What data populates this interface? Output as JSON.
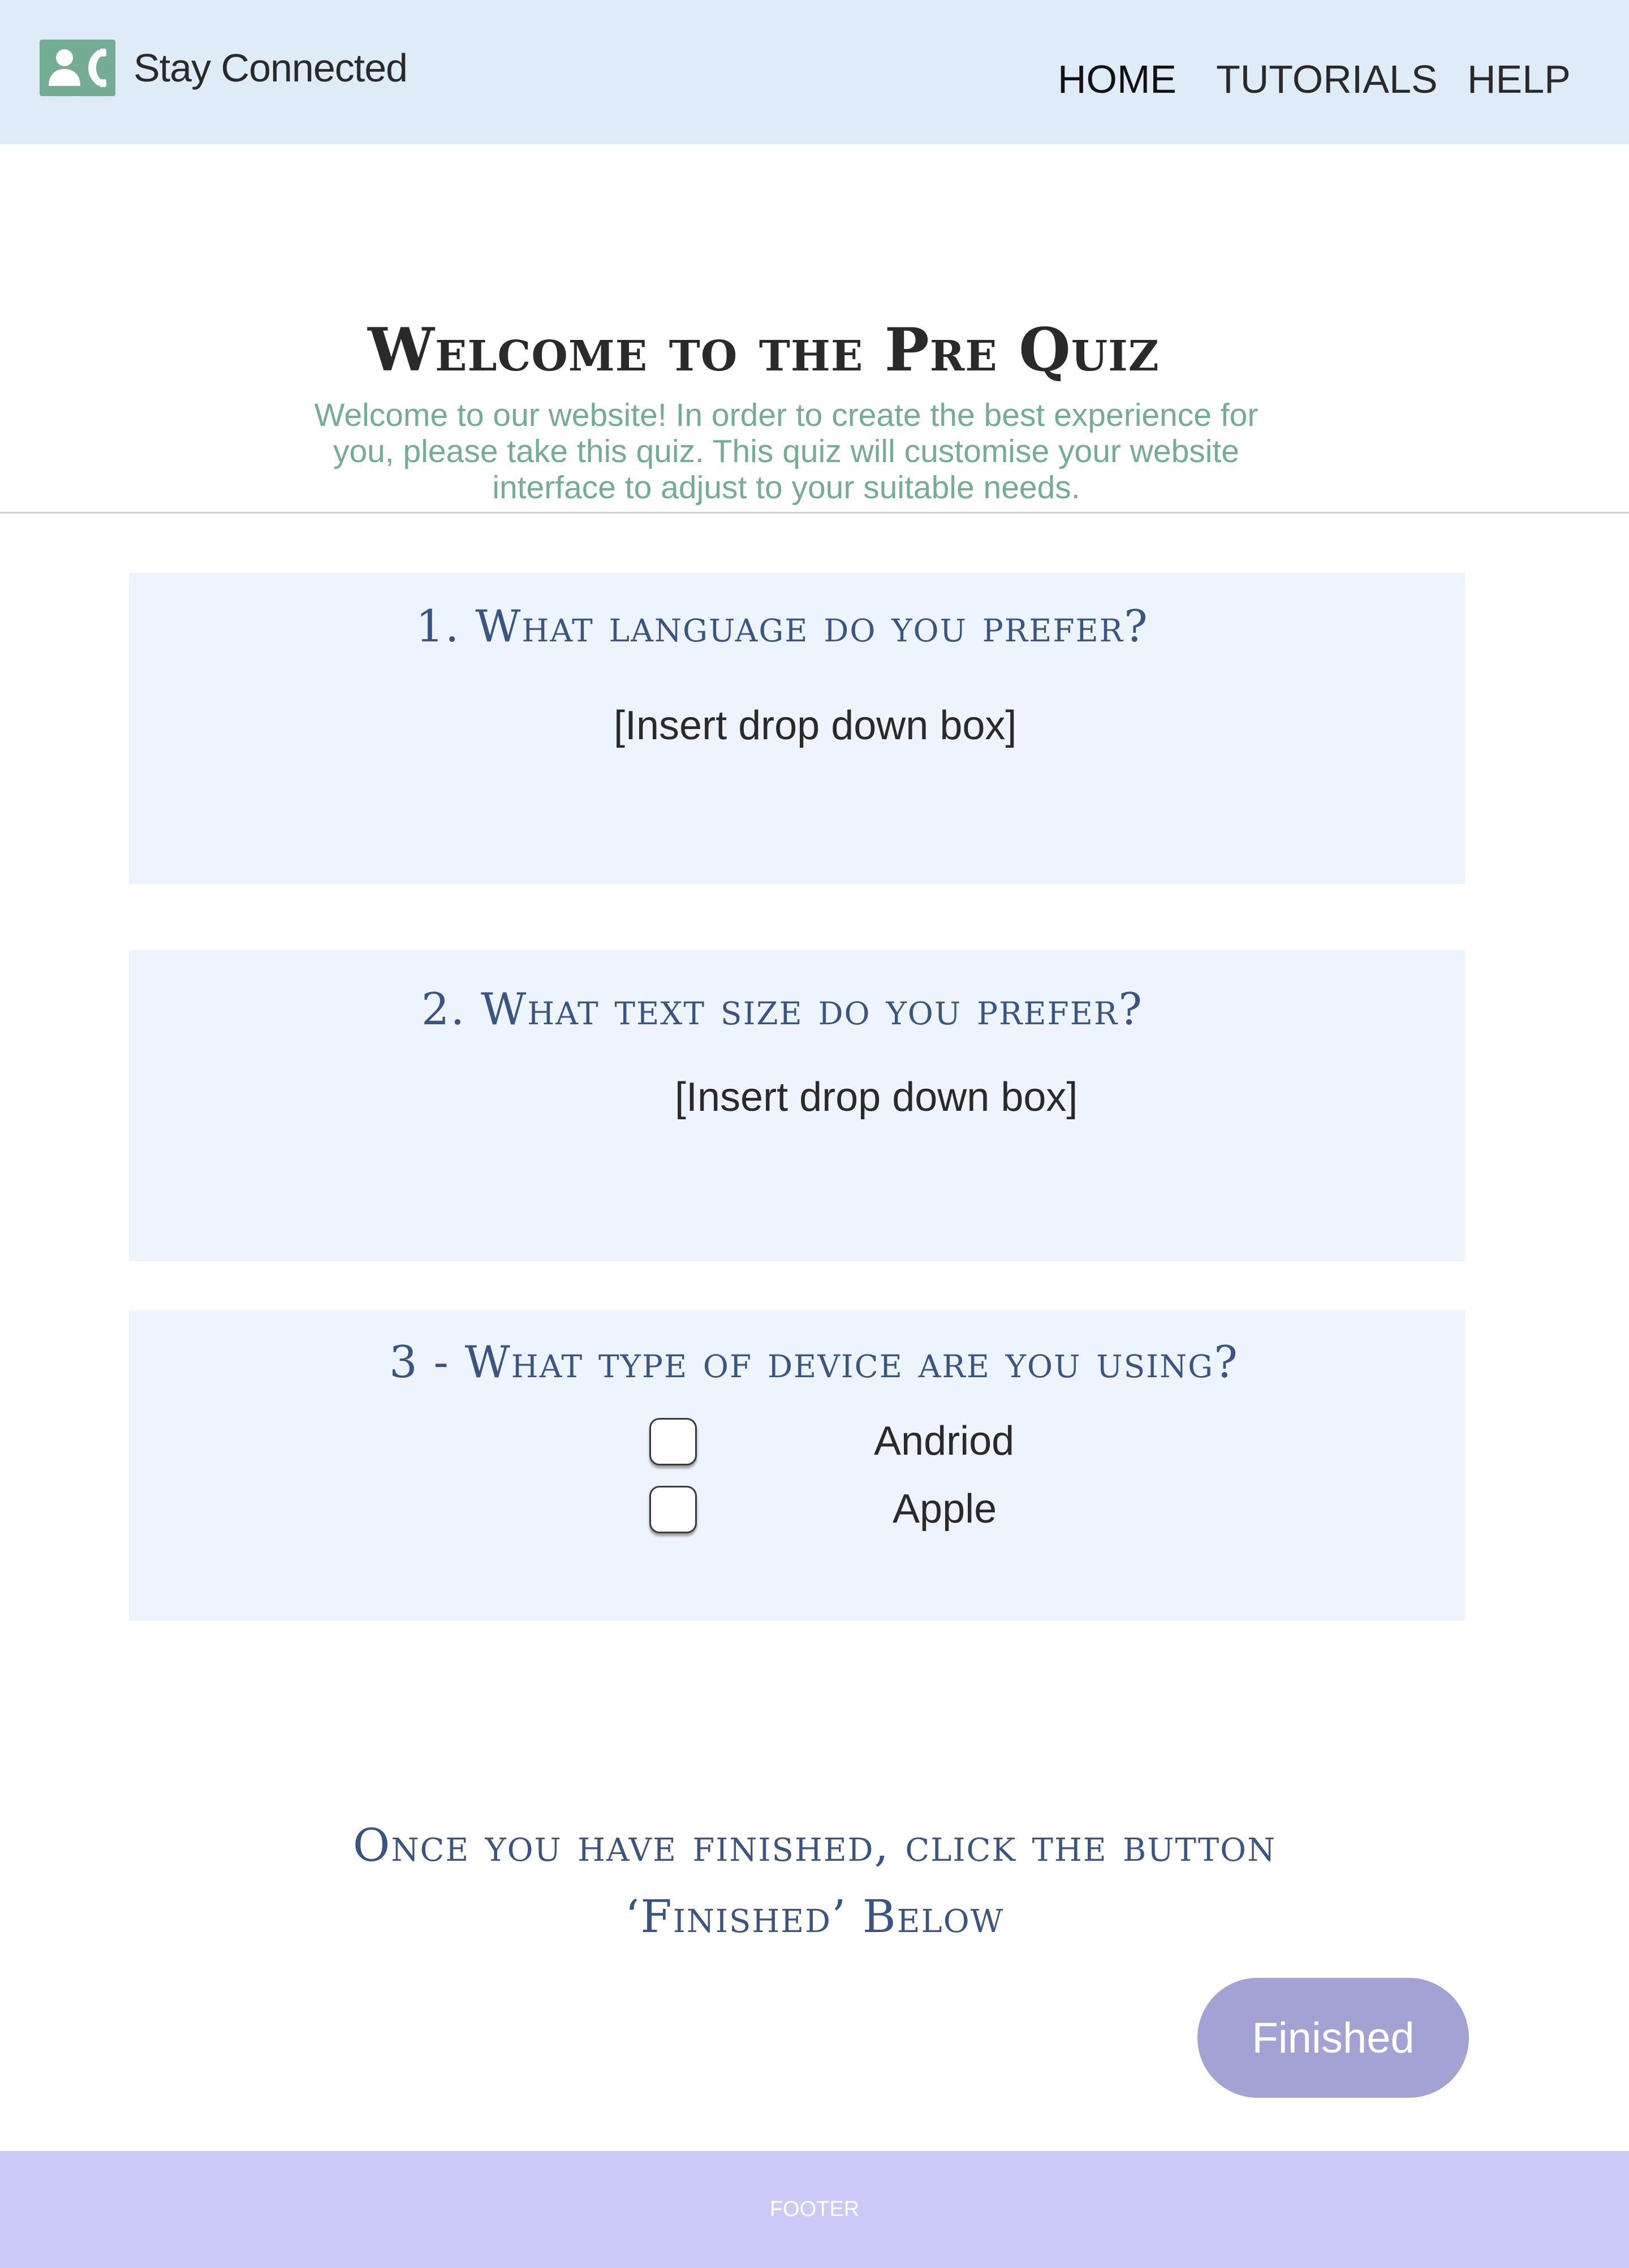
{
  "header": {
    "brand": "Stay Connected",
    "logo_icon": "contact-phone-icon",
    "nav": {
      "home": "HOME",
      "tutorials": "TUTORIALS",
      "help": "HELP"
    }
  },
  "intro": {
    "title": "Welcome to the Pre Quiz",
    "description": "Welcome to our website! In order to create the best experience for you, please take this quiz. This quiz will customise your website interface to adjust to your suitable needs."
  },
  "questions": [
    {
      "title": "1. What language do you prefer?",
      "placeholder": "[Insert drop down box]"
    },
    {
      "title": "2. What text size do you prefer?",
      "placeholder": "[Insert drop down box]"
    },
    {
      "title": "3 - What type of device are you using?",
      "options": [
        {
          "label": "Andriod",
          "checked": false
        },
        {
          "label": "Apple",
          "checked": false
        }
      ]
    }
  ],
  "closing": {
    "text": "Once you have finished, click the button ‘Finished’ Below"
  },
  "finished_button": {
    "label": "Finished"
  },
  "footer": {
    "text": "FOOTER"
  },
  "colors": {
    "header_bg": "#e0ebf8",
    "card_bg": "#eef4fd",
    "accent_green": "#74ad94",
    "heading_blue": "#3a5483",
    "button_bg": "#a3a2d5",
    "footer_bg": "#cbc9f6"
  }
}
